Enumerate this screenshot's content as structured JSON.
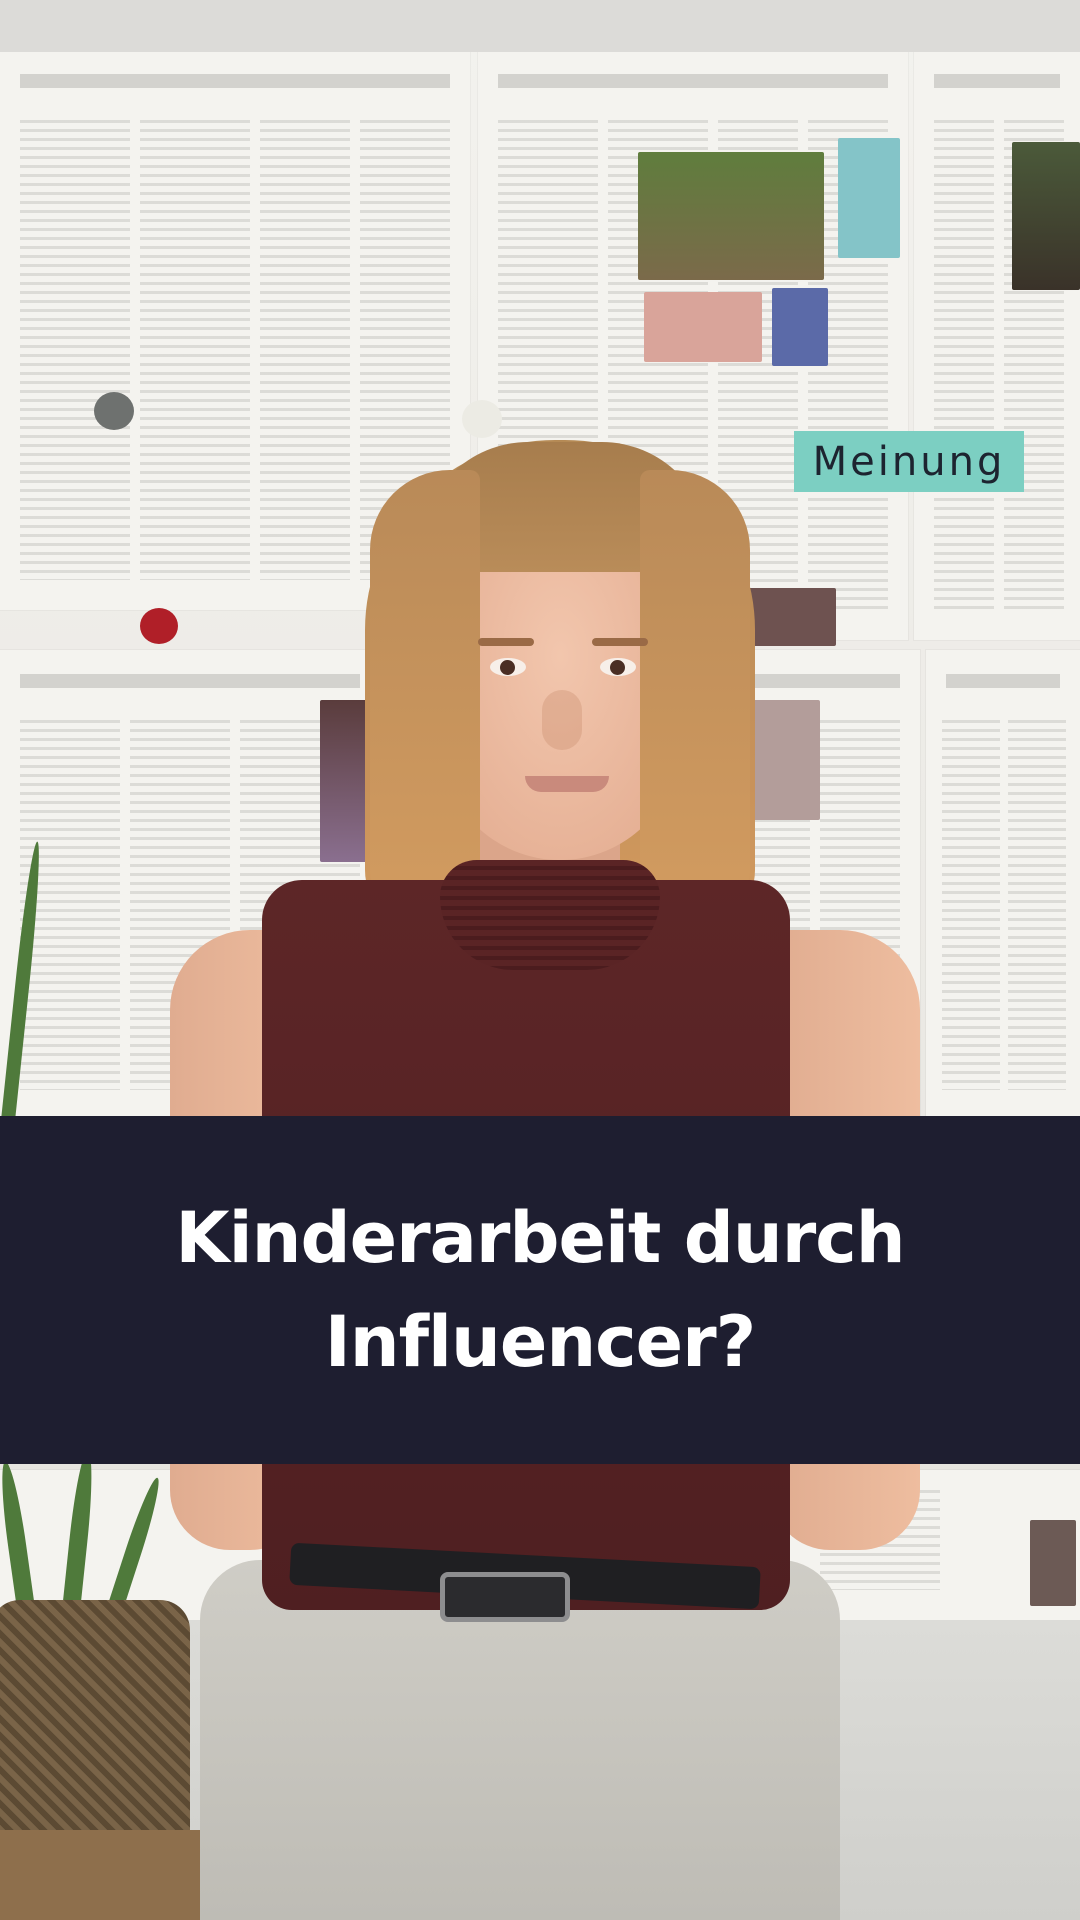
{
  "video": {
    "category_tag": "Meinung",
    "title_lines": [
      "Kinderarbeit durch",
      "Influencer?"
    ]
  },
  "colors": {
    "tag_background": "#7ccfc2",
    "tag_text": "#1d2430",
    "title_band": "#1e1e30",
    "title_text": "#ffffff",
    "top_garment": "#5d2627"
  }
}
